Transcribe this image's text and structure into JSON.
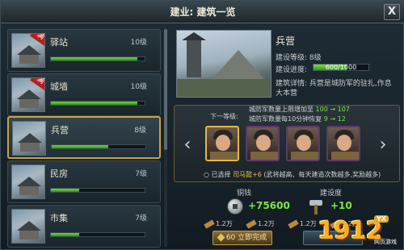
{
  "window": {
    "title": "建业: 建筑一览",
    "close_label": "X"
  },
  "buildings": [
    {
      "name": "驿站",
      "level": "10级",
      "progress": 0.92,
      "tag": "满"
    },
    {
      "name": "城墙",
      "level": "10级",
      "progress": 0.92,
      "tag": "满"
    },
    {
      "name": "兵营",
      "level": "8级",
      "progress": 0.6,
      "tag": ""
    },
    {
      "name": "民房",
      "level": "7级",
      "progress": 0.3,
      "tag": ""
    },
    {
      "name": "市集",
      "level": "7级",
      "progress": 0.3,
      "tag": ""
    }
  ],
  "detail": {
    "name": "兵营",
    "level_line": "建设等级: 8级",
    "progress_label": "建设进度:",
    "progress_text": "600/1000",
    "progress": 0.6,
    "desc_line1": "建筑详情: 兵营是城防军的驻扎,作息",
    "desc_line2": "大本营"
  },
  "upgrade": {
    "next_label": "下一等级:",
    "line1": "城防军数量上限增加至",
    "line1_old": "100",
    "line1_new": "107",
    "line2": "城防军数量每10分钟恢复",
    "line2_old": "9",
    "line2_new": "12",
    "arrow": "→",
    "prev_label": "‹",
    "next_btn_label": "›",
    "selected_prefix": "○ 已选择",
    "selected_hero": "司马懿+6",
    "selected_suffix": "(武将越高、每天建造次数越多,奖励越多)"
  },
  "resources": {
    "silver_label": "铜钱",
    "silver_value": "+75600",
    "build_label": "建设度",
    "build_value": "+10"
  },
  "costs": [
    "1.2万",
    "1.2万",
    "1.2万",
    "1.2万"
  ],
  "actions": {
    "finish_label": "60  立即完成"
  },
  "logo": {
    "number": "1912",
    "badge": "YX",
    "sub": "网页游戏"
  }
}
